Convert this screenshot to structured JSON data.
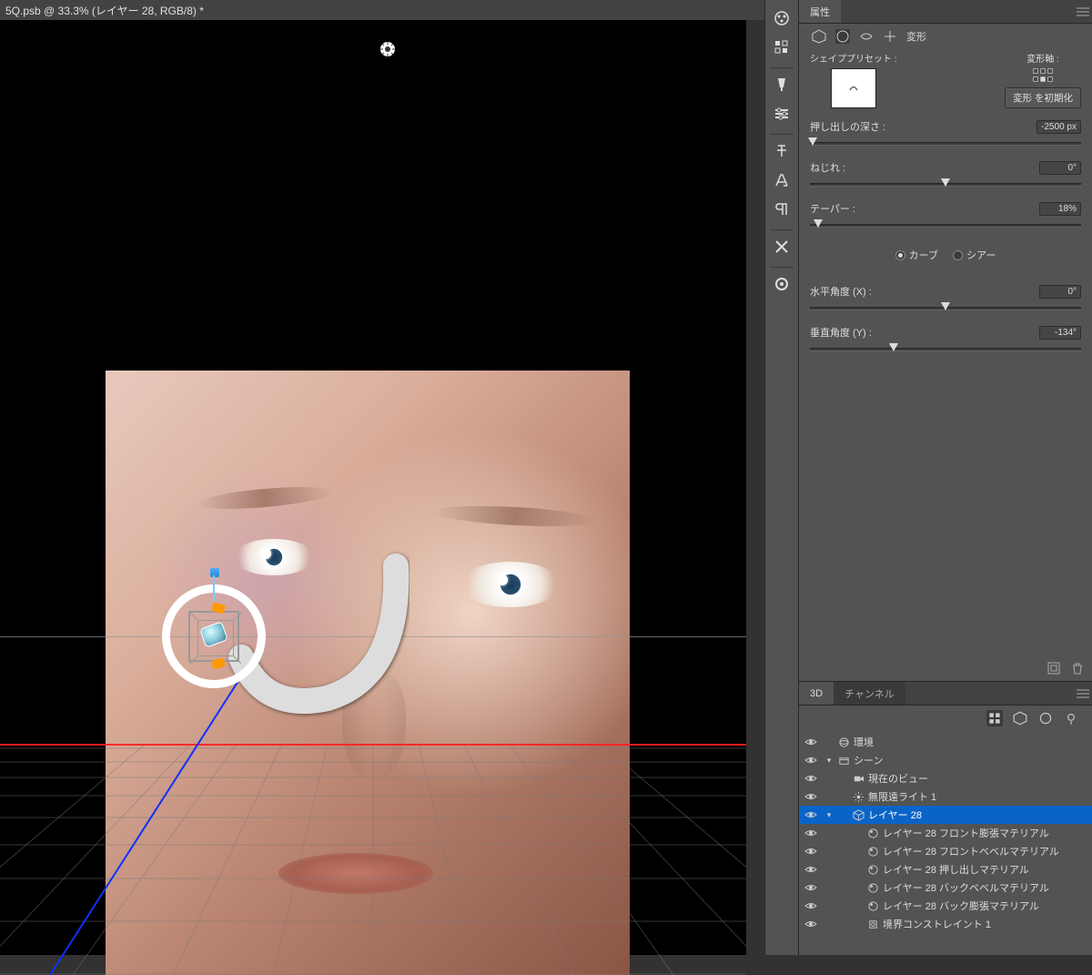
{
  "title_bar": {
    "text": "5Q.psb @ 33.3% (レイヤー 28, RGB/8) *"
  },
  "properties_panel": {
    "tab": "属性",
    "section_title": "変形",
    "shape_preset_label": "シェイププリセット :",
    "deform_axis_label": "変形軸 :",
    "reset_button": "変形 を初期化",
    "sliders": {
      "extrude": {
        "label": "押し出しの深さ :",
        "value": "-2500 px",
        "pos": 0.01
      },
      "twist": {
        "label": "ねじれ :",
        "value": "0°",
        "pos": 0.5
      },
      "taper": {
        "label": "テーパー :",
        "value": "18%",
        "pos": 0.03
      },
      "hangle": {
        "label": "水平角度 (X) :",
        "value": "0°",
        "pos": 0.5
      },
      "vangle": {
        "label": "垂直角度 (Y) :",
        "value": "-134°",
        "pos": 0.31
      }
    },
    "radio": {
      "curve": "カーブ",
      "shear": "シアー",
      "checked": "curve"
    }
  },
  "threeD_panel": {
    "tab_active": "3D",
    "tab_inactive": "チャンネル",
    "tree": [
      {
        "depth": 0,
        "vis": true,
        "twisty": "",
        "icon": "env",
        "label": "環境",
        "sel": false
      },
      {
        "depth": 0,
        "vis": true,
        "twisty": "v",
        "icon": "scene",
        "label": "シーン",
        "sel": false
      },
      {
        "depth": 1,
        "vis": true,
        "twisty": "",
        "icon": "camera",
        "label": "現在のビュー",
        "sel": false
      },
      {
        "depth": 1,
        "vis": true,
        "twisty": "",
        "icon": "light",
        "label": "無限遠ライト 1",
        "sel": false
      },
      {
        "depth": 1,
        "vis": true,
        "twisty": "v",
        "icon": "mesh",
        "label": "レイヤー 28",
        "sel": true
      },
      {
        "depth": 2,
        "vis": true,
        "twisty": "",
        "icon": "mat",
        "label": "レイヤー 28 フロント膨張マテリアル",
        "sel": false
      },
      {
        "depth": 2,
        "vis": true,
        "twisty": "",
        "icon": "mat",
        "label": "レイヤー 28 フロントベベルマテリアル",
        "sel": false
      },
      {
        "depth": 2,
        "vis": true,
        "twisty": "",
        "icon": "mat",
        "label": "レイヤー 28 押し出しマテリアル",
        "sel": false
      },
      {
        "depth": 2,
        "vis": true,
        "twisty": "",
        "icon": "mat",
        "label": "レイヤー 28 バックベベルマテリアル",
        "sel": false
      },
      {
        "depth": 2,
        "vis": true,
        "twisty": "",
        "icon": "mat",
        "label": "レイヤー 28 バック膨張マテリアル",
        "sel": false
      },
      {
        "depth": 2,
        "vis": true,
        "twisty": "",
        "icon": "constraint",
        "label": "境界コンストレイント 1",
        "sel": false
      }
    ]
  }
}
